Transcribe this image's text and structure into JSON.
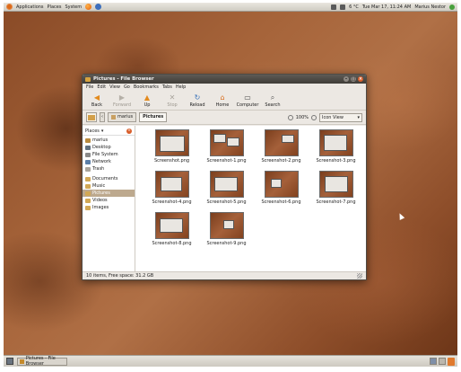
{
  "top_panel": {
    "menus": [
      "Applications",
      "Places",
      "System"
    ],
    "weather": "6 °C",
    "clock": "Tue Mar 17, 11:24 AM",
    "user": "Marius Nestor"
  },
  "window": {
    "title": "Pictures - File Browser",
    "menu": [
      "File",
      "Edit",
      "View",
      "Go",
      "Bookmarks",
      "Tabs",
      "Help"
    ],
    "toolbar": [
      {
        "label": "Back",
        "icon": "back-arrow-icon",
        "glyph": "◀",
        "color": "#e38a1d",
        "enabled": true
      },
      {
        "label": "Forward",
        "icon": "forward-arrow-icon",
        "glyph": "▶",
        "color": "#b5b0a8",
        "enabled": false
      },
      {
        "label": "Up",
        "icon": "up-arrow-icon",
        "glyph": "▲",
        "color": "#e38a1d",
        "enabled": true
      },
      {
        "label": "Stop",
        "icon": "stop-icon",
        "glyph": "✕",
        "color": "#a9a49c",
        "enabled": false
      },
      {
        "label": "Reload",
        "icon": "reload-icon",
        "glyph": "↻",
        "color": "#3b73b9",
        "enabled": true
      },
      {
        "label": "Home",
        "icon": "home-icon",
        "glyph": "⌂",
        "color": "#d96e1f",
        "enabled": true
      },
      {
        "label": "Computer",
        "icon": "computer-icon",
        "glyph": "▭",
        "color": "#4a4a4a",
        "enabled": true
      },
      {
        "label": "Search",
        "icon": "search-icon",
        "glyph": "⌕",
        "color": "#555555",
        "enabled": true
      }
    ],
    "location": {
      "crumbs": [
        "marius",
        "Pictures"
      ],
      "zoom": "100%",
      "view": "Icon View"
    },
    "sidebar": {
      "header": "Places",
      "items": [
        {
          "label": "marius",
          "icon": "ic-home"
        },
        {
          "label": "Desktop",
          "icon": "ic-desktop"
        },
        {
          "label": "File System",
          "icon": "ic-fs"
        },
        {
          "label": "Network",
          "icon": "ic-net"
        },
        {
          "label": "Trash",
          "icon": "ic-trash"
        },
        {
          "sep": true
        },
        {
          "label": "Documents",
          "icon": "ic-folder"
        },
        {
          "label": "Music",
          "icon": "ic-folder"
        },
        {
          "label": "Pictures",
          "icon": "ic-folder",
          "selected": true
        },
        {
          "label": "Videos",
          "icon": "ic-folder"
        },
        {
          "label": "Images",
          "icon": "ic-folder"
        }
      ]
    },
    "files": [
      "Screenshot.png",
      "Screenshot-1.png",
      "Screenshot-2.png",
      "Screenshot-3.png",
      "Screenshot-4.png",
      "Screenshot-5.png",
      "Screenshot-6.png",
      "Screenshot-7.png",
      "Screenshot-8.png",
      "Screenshot-9.png"
    ],
    "status": "10 items, Free space: 31.2 GB"
  },
  "bottom_panel": {
    "task": "Pictures - File Browser"
  },
  "colors": {
    "accent": "#dd6a19",
    "selection": "#bda98e"
  }
}
